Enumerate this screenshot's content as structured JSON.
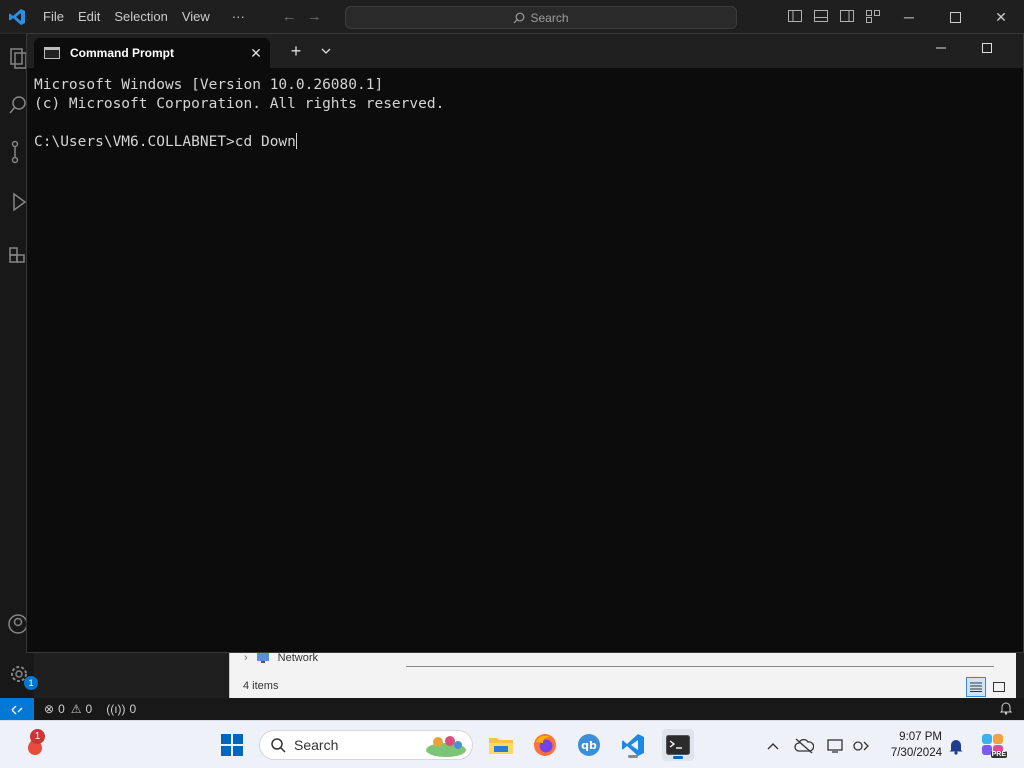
{
  "vscode": {
    "menu": [
      "File",
      "Edit",
      "Selection",
      "View",
      "···"
    ],
    "search_placeholder": "Search",
    "status": {
      "errors": "0",
      "warnings": "0",
      "ports": "0"
    },
    "settings_badge": "1"
  },
  "explorer_peek": {
    "network_label": "Network",
    "items_count": "4 items"
  },
  "cmd": {
    "tab_title": "Command Prompt",
    "lines": [
      "Microsoft Windows [Version 10.0.26080.1]",
      "(c) Microsoft Corporation. All rights reserved.",
      "",
      "C:\\Users\\VM6.COLLABNET>cd Down"
    ]
  },
  "taskbar": {
    "search_label": "Search",
    "notification_badge": "1",
    "clock_time": "9:07 PM",
    "clock_date": "7/30/2024",
    "copilot_badge": "PRE"
  },
  "colors": {
    "vscode_accent": "#0078d4",
    "terminal_bg": "#0c0c0c",
    "terminal_text": "#d4d4d4"
  }
}
